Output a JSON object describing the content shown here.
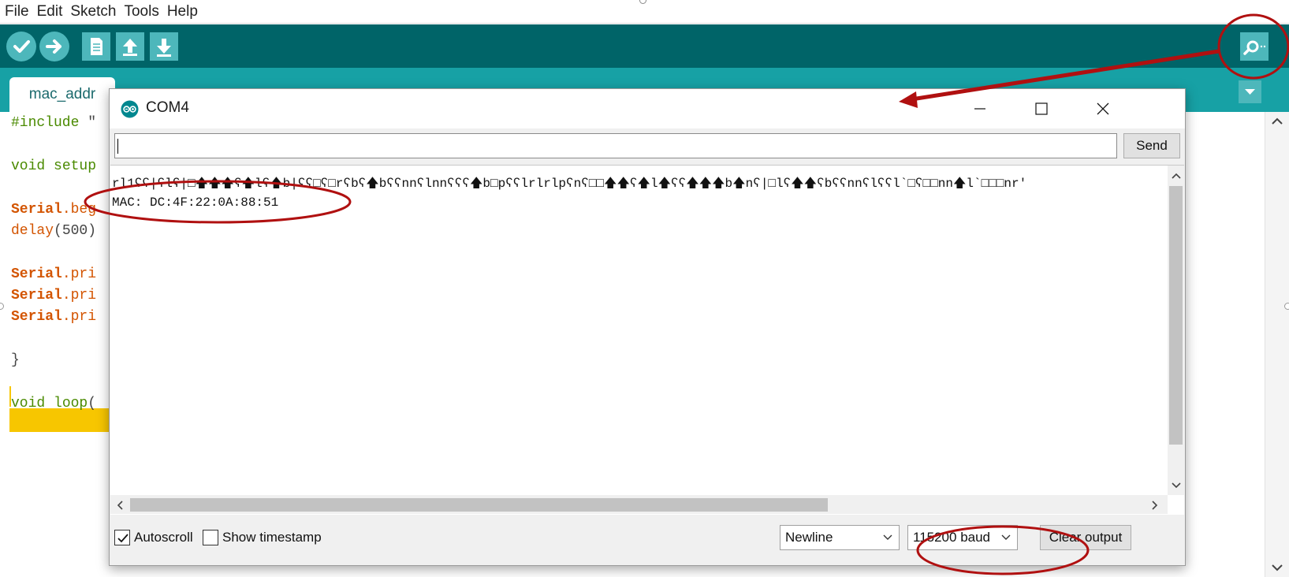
{
  "menu": [
    "File",
    "Edit",
    "Sketch",
    "Tools",
    "Help"
  ],
  "toolbar": {
    "buttons": [
      "verify-icon",
      "upload-icon",
      "new-icon",
      "open-icon",
      "save-icon"
    ],
    "serial_monitor_icon": "magnifier-icon"
  },
  "editor": {
    "tab_label": "mac_addr",
    "code": {
      "l1a": "#include ",
      "l1b": "\"",
      "l2a": "void ",
      "l2b": "setup",
      "l3a": "Serial",
      "l3b": ".beg",
      "l4a": "delay",
      "l4b": "(500)",
      "l5a": "Serial",
      "l5b": ".pri",
      "l6a": "Serial",
      "l6b": ".pri",
      "l7a": "Serial",
      "l7b": ".pri",
      "l8": "}",
      "l9a": "void ",
      "l9b": "loop",
      "l9c": "("
    }
  },
  "serial_monitor": {
    "title": "COM4",
    "input_value": "",
    "send_label": "Send",
    "output_lines": [
      "rl1ʕʕ|ʕlʕ|□🡅🡅🡅ʕ🡅lʕ🡅b|ʕʕ□ʕ□rʕbʕ🡅bʕʕnnʕlnnʕʕʕ🡅b□pʕʕlrlrlpʕnʕ□□🡅🡅ʕ🡅l🡅ʕʕ🡅🡅🡅b🡅nʕ|□lʕ🡅🡅ʕbʕʕnnʕlʕʕl`□ʕ□□nn🡅l`□□□nr'",
      "MAC: DC:4F:22:0A:88:51"
    ],
    "autoscroll_label": "Autoscroll",
    "autoscroll_checked": true,
    "timestamp_label": "Show timestamp",
    "timestamp_checked": false,
    "line_ending": "Newline",
    "baud_rate": "115200 baud",
    "clear_label": "Clear output"
  },
  "colors": {
    "toolbar": "#006468",
    "tabstrip": "#17a1a5",
    "button": "#4db7bb",
    "annotation": "#b01010"
  }
}
